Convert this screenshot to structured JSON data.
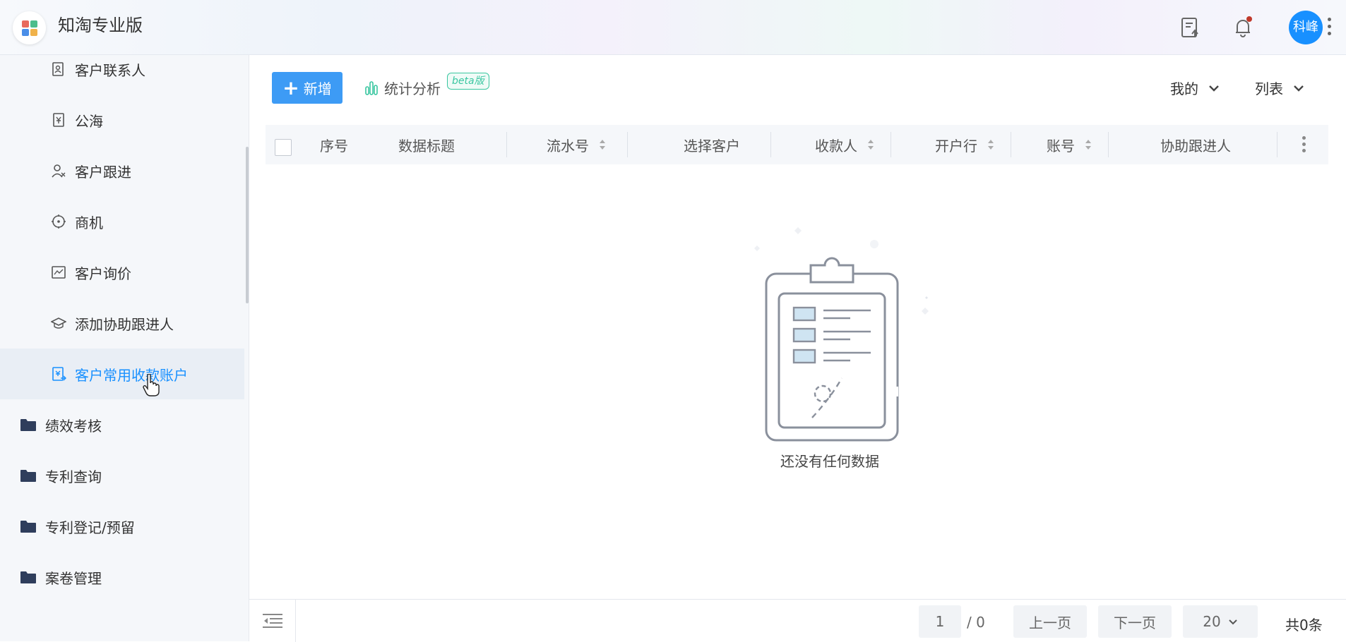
{
  "header": {
    "app_title": "知淘专业版",
    "avatar_text": "科峰",
    "notification_badge_color": "#c0392b"
  },
  "sidebar": {
    "sub_items": [
      {
        "label": "客户联系人",
        "icon": "contact-card-icon"
      },
      {
        "label": "公海",
        "icon": "yen-doc-icon"
      },
      {
        "label": "客户跟进",
        "icon": "user-follow-icon"
      },
      {
        "label": "商机",
        "icon": "target-icon"
      },
      {
        "label": "客户询价",
        "icon": "chart-icon"
      },
      {
        "label": "添加协助跟进人",
        "icon": "graduation-cap-icon"
      },
      {
        "label": "客户常用收款账户",
        "icon": "account-icon",
        "active": true
      }
    ],
    "folders": [
      {
        "label": "绩效考核"
      },
      {
        "label": "专利查询"
      },
      {
        "label": "专利登记/预留"
      },
      {
        "label": "案卷管理"
      }
    ]
  },
  "toolbar": {
    "add_label": "新增",
    "stats_label": "统计分析",
    "beta_label": "beta版",
    "mine_label": "我的",
    "view_label": "列表"
  },
  "table": {
    "columns": [
      "序号",
      "数据标题",
      "流水号",
      "选择客户",
      "收款人",
      "开户行",
      "账号",
      "协助跟进人"
    ]
  },
  "empty": {
    "message": "还没有任何数据"
  },
  "pagination": {
    "current_page": "1",
    "total_pages": "/ 0",
    "prev_label": "上一页",
    "next_label": "下一页",
    "page_size": "20",
    "total_label": "共0条"
  },
  "colors": {
    "accent": "#1890ff",
    "add_button": "#3d9bf5",
    "beta": "#39c6a0"
  }
}
